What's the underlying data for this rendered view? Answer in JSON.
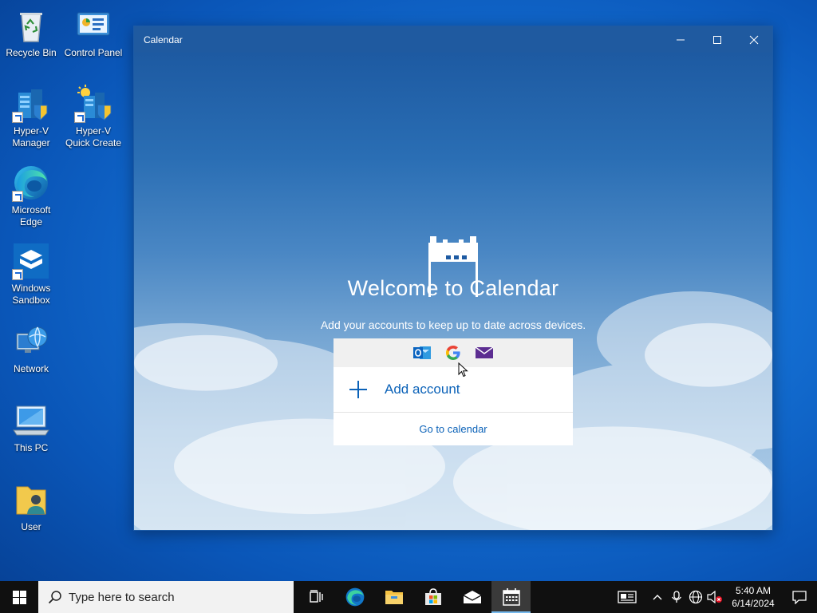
{
  "desktop": {
    "icons": [
      {
        "id": "recycle-bin",
        "label": "Recycle Bin"
      },
      {
        "id": "control-panel",
        "label": "Control Panel"
      },
      {
        "id": "hyperv-manager",
        "label": "Hyper-V Manager"
      },
      {
        "id": "hyperv-quick-create",
        "label": "Hyper-V Quick Create"
      },
      {
        "id": "microsoft-edge",
        "label": "Microsoft Edge"
      },
      {
        "id": "windows-sandbox",
        "label": "Windows Sandbox"
      },
      {
        "id": "network",
        "label": "Network"
      },
      {
        "id": "this-pc",
        "label": "This PC"
      },
      {
        "id": "user",
        "label": "User"
      }
    ]
  },
  "window": {
    "title": "Calendar",
    "welcome_title": "Welcome to Calendar",
    "welcome_subtitle": "Add your accounts to keep up to date across devices.",
    "providers": [
      "outlook-icon",
      "google-icon",
      "mail-icon"
    ],
    "add_account_label": "Add account",
    "goto_calendar_label": "Go to calendar"
  },
  "taskbar": {
    "search_placeholder": "Type here to search",
    "apps": [
      "task-view",
      "microsoft-edge",
      "file-explorer",
      "microsoft-store",
      "mail",
      "calendar"
    ],
    "active_app": "calendar",
    "clock_time": "5:40 AM",
    "clock_date": "6/14/2024"
  },
  "colors": {
    "accent": "#0b62b8",
    "titlebar": "#1f5aa0",
    "taskbar": "#101010"
  }
}
